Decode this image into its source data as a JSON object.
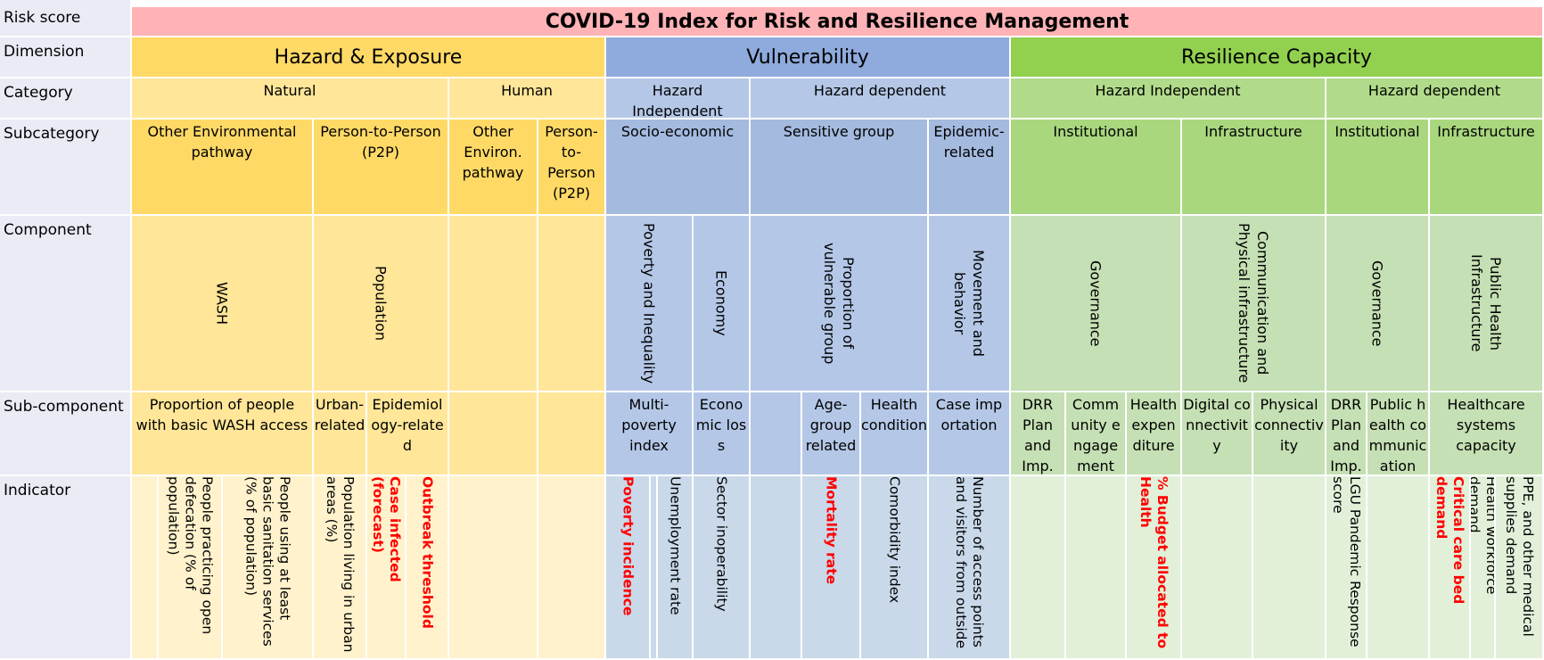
{
  "row_labels": {
    "risk_score": "Risk score",
    "dimension": "Dimension",
    "category": "Category",
    "subcategory": "Subcategory",
    "component": "Component",
    "sub_component": "Sub-component",
    "indicator": "Indicator"
  },
  "title": "COVID-19 Index for Risk and Resilience Management",
  "dimensions": {
    "hazard": "Hazard & Exposure",
    "vulnerability": "Vulnerability",
    "resilience": "Resilience Capacity"
  },
  "categories": {
    "natural": "Natural",
    "human": "Human",
    "v_independent": "Hazard Independent",
    "v_dependent": "Hazard dependent",
    "r_independent": "Hazard Independent",
    "r_dependent": "Hazard dependent"
  },
  "subcategories": {
    "other_env": "Other Environmental pathway",
    "p2p": "Person-to-Person (P2P)",
    "other_env_short": "Other Environ. pathway",
    "p2p_short": "Person-to-Person (P2P)",
    "socio": "Socio-economic",
    "sensitive": "Sensitive group",
    "epidemic": "Epidemic-related",
    "institutional_1": "Institutional",
    "infrastructure_1": "Infrastructure",
    "institutional_2": "Institutional",
    "infrastructure_2": "Infrastructure"
  },
  "components": {
    "wash": "WASH",
    "population": "Population",
    "poverty": "Poverty and Inequality",
    "economy": "Economy",
    "vulnerable": "Proportion of vulnerable group",
    "movement": "Movement and behavior",
    "governance_1": "Governance",
    "comm_infra": "Communication and Physical infrastructure",
    "governance_2": "Governance",
    "public_health": "Public Health Infrastructure"
  },
  "sub_components": {
    "wash_prop": "Proportion of people with basic WASH access",
    "urban": "Urban-related",
    "epi": "Epidemiology-related",
    "multipov": "Multi-poverty index",
    "econloss": "Economic loss",
    "age": "Age-group related",
    "health": "Health condition",
    "case_imp": "Case importation",
    "drr_1": "DRR Plan and Imp.",
    "community": "Community engagement",
    "health_exp": "Health expenditure",
    "digital": "Digital connectivity",
    "physical": "Physical connectivity",
    "drr_2": "DRR Plan and Imp.",
    "ph_comm": "Public health communication",
    "hc_capacity": "Healthcare systems capacity"
  },
  "indicators": {
    "open_defecation": "People practicing open defecation (% of population)",
    "sanitation": "People using at least basic sanitation services (% of population)",
    "urban_pop": "Population living in urban areas (%)",
    "case_forecast": "Case infected (forecast)",
    "outbreak": "Outbreak threshold",
    "poverty_inc": "Poverty incidence",
    "unemployment": "Unemployment rate",
    "sector": "Sector inoperability",
    "mortality": "Mortality rate",
    "comorbidity": "Comorbidity index",
    "access_points": "Number of access points and visitors from outside",
    "budget": "% Budget allocated to Health",
    "lgu": "LGU Pandemic Response score",
    "critical_care": "Critical care bed demand",
    "workforce": "Health workforce demand",
    "ppe": "PPE, and other medical supplies demand"
  },
  "colors": {
    "label_col": "#e9ebf5",
    "title": "#ffb3b6",
    "hazard_dim": "#ffd966",
    "hazard_light": "#ffe699",
    "hazard_lighter": "#fff2cc",
    "vul_dim": "#8faadc",
    "vul_light": "#b4c7e7",
    "vul_lighter": "#dae3f3",
    "res_dim": "#92d050",
    "res_light": "#c5e0b4",
    "res_lighter": "#e2f0d9",
    "highlight": "#ff0000"
  }
}
